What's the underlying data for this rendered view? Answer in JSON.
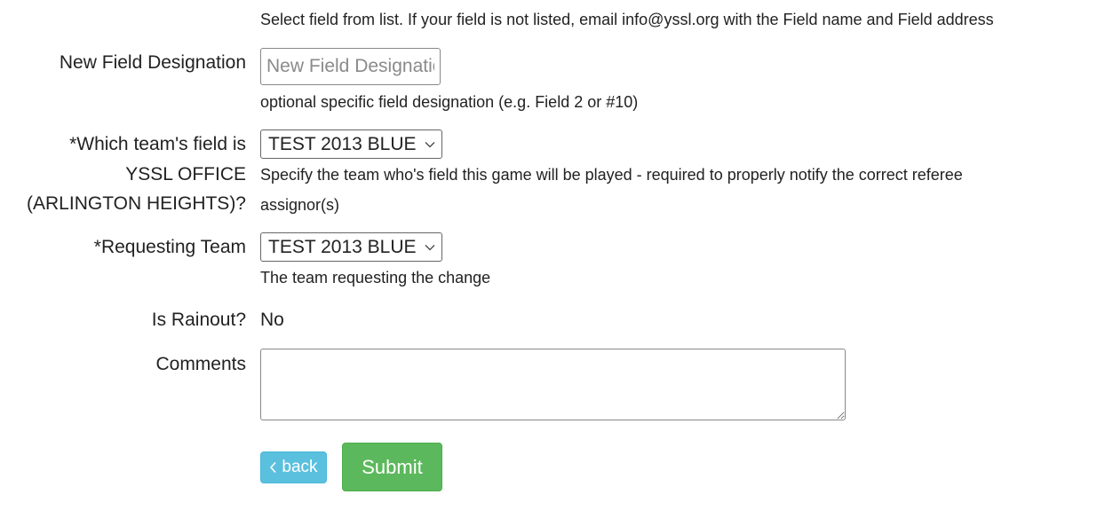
{
  "field_help": "Select field from list. If your field is not listed, email info@yssl.org with the Field name and Field address",
  "new_field_designation": {
    "label": "New Field Designation",
    "placeholder": "New Field Designation",
    "value": "",
    "help": "optional specific field designation (e.g. Field 2 or #10)"
  },
  "which_team_field": {
    "label_line1": "*Which team's field is",
    "label_line2": "YSSL OFFICE",
    "label_line3": "(ARLINGTON HEIGHTS)?",
    "selected": "TEST 2013 BLUE",
    "help_line1": "Specify the team who's field this game will be played - required to properly notify the correct referee",
    "help_line2": "assignor(s)"
  },
  "requesting_team": {
    "label": "*Requesting Team",
    "selected": "TEST 2013 BLUE",
    "help": "The team requesting the change"
  },
  "rainout": {
    "label": "Is Rainout?",
    "value": "No"
  },
  "comments": {
    "label": "Comments",
    "value": ""
  },
  "buttons": {
    "back_label": "back",
    "submit_label": "Submit"
  },
  "icons": {
    "select_chevron": "chevron-down-icon",
    "back_chevron": "chevron-left-icon"
  },
  "colors": {
    "back_button": "#5bc0de",
    "submit_button": "#5cb85c"
  }
}
